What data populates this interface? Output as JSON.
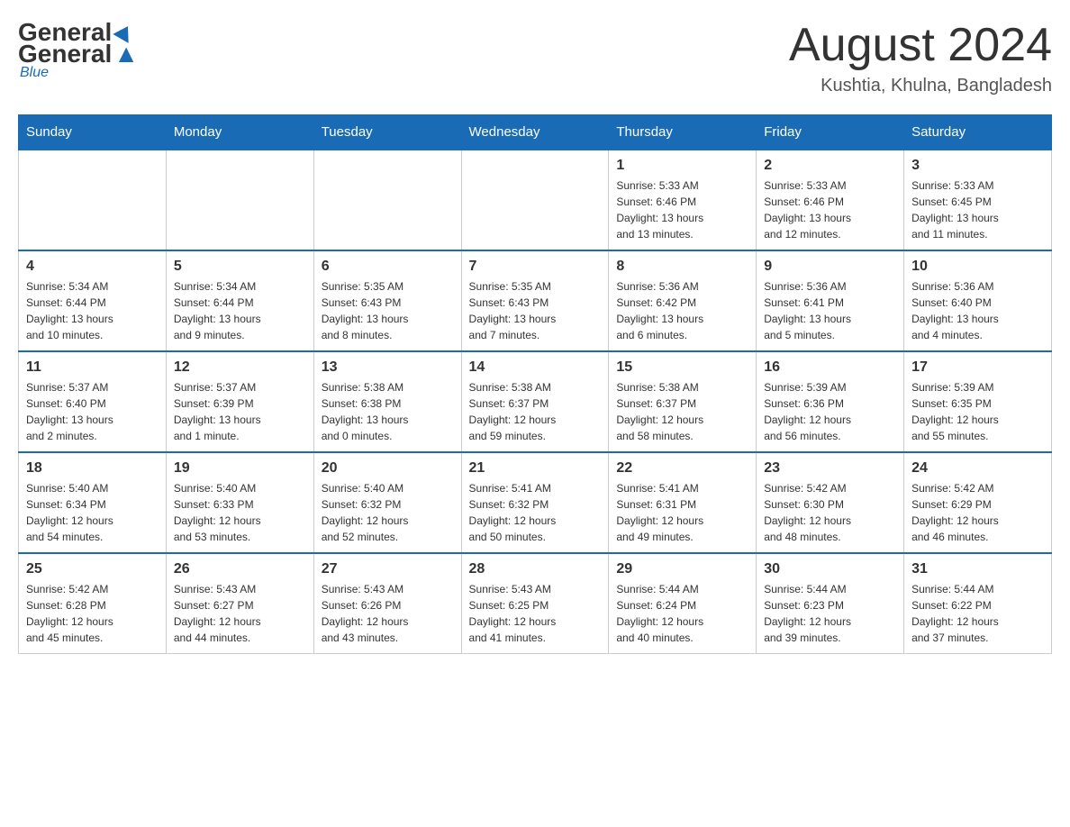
{
  "header": {
    "logo_general": "General",
    "logo_blue": "Blue",
    "month_title": "August 2024",
    "location": "Kushtia, Khulna, Bangladesh"
  },
  "weekdays": [
    "Sunday",
    "Monday",
    "Tuesday",
    "Wednesday",
    "Thursday",
    "Friday",
    "Saturday"
  ],
  "weeks": [
    [
      {
        "day": "",
        "info": ""
      },
      {
        "day": "",
        "info": ""
      },
      {
        "day": "",
        "info": ""
      },
      {
        "day": "",
        "info": ""
      },
      {
        "day": "1",
        "info": "Sunrise: 5:33 AM\nSunset: 6:46 PM\nDaylight: 13 hours\nand 13 minutes."
      },
      {
        "day": "2",
        "info": "Sunrise: 5:33 AM\nSunset: 6:46 PM\nDaylight: 13 hours\nand 12 minutes."
      },
      {
        "day": "3",
        "info": "Sunrise: 5:33 AM\nSunset: 6:45 PM\nDaylight: 13 hours\nand 11 minutes."
      }
    ],
    [
      {
        "day": "4",
        "info": "Sunrise: 5:34 AM\nSunset: 6:44 PM\nDaylight: 13 hours\nand 10 minutes."
      },
      {
        "day": "5",
        "info": "Sunrise: 5:34 AM\nSunset: 6:44 PM\nDaylight: 13 hours\nand 9 minutes."
      },
      {
        "day": "6",
        "info": "Sunrise: 5:35 AM\nSunset: 6:43 PM\nDaylight: 13 hours\nand 8 minutes."
      },
      {
        "day": "7",
        "info": "Sunrise: 5:35 AM\nSunset: 6:43 PM\nDaylight: 13 hours\nand 7 minutes."
      },
      {
        "day": "8",
        "info": "Sunrise: 5:36 AM\nSunset: 6:42 PM\nDaylight: 13 hours\nand 6 minutes."
      },
      {
        "day": "9",
        "info": "Sunrise: 5:36 AM\nSunset: 6:41 PM\nDaylight: 13 hours\nand 5 minutes."
      },
      {
        "day": "10",
        "info": "Sunrise: 5:36 AM\nSunset: 6:40 PM\nDaylight: 13 hours\nand 4 minutes."
      }
    ],
    [
      {
        "day": "11",
        "info": "Sunrise: 5:37 AM\nSunset: 6:40 PM\nDaylight: 13 hours\nand 2 minutes."
      },
      {
        "day": "12",
        "info": "Sunrise: 5:37 AM\nSunset: 6:39 PM\nDaylight: 13 hours\nand 1 minute."
      },
      {
        "day": "13",
        "info": "Sunrise: 5:38 AM\nSunset: 6:38 PM\nDaylight: 13 hours\nand 0 minutes."
      },
      {
        "day": "14",
        "info": "Sunrise: 5:38 AM\nSunset: 6:37 PM\nDaylight: 12 hours\nand 59 minutes."
      },
      {
        "day": "15",
        "info": "Sunrise: 5:38 AM\nSunset: 6:37 PM\nDaylight: 12 hours\nand 58 minutes."
      },
      {
        "day": "16",
        "info": "Sunrise: 5:39 AM\nSunset: 6:36 PM\nDaylight: 12 hours\nand 56 minutes."
      },
      {
        "day": "17",
        "info": "Sunrise: 5:39 AM\nSunset: 6:35 PM\nDaylight: 12 hours\nand 55 minutes."
      }
    ],
    [
      {
        "day": "18",
        "info": "Sunrise: 5:40 AM\nSunset: 6:34 PM\nDaylight: 12 hours\nand 54 minutes."
      },
      {
        "day": "19",
        "info": "Sunrise: 5:40 AM\nSunset: 6:33 PM\nDaylight: 12 hours\nand 53 minutes."
      },
      {
        "day": "20",
        "info": "Sunrise: 5:40 AM\nSunset: 6:32 PM\nDaylight: 12 hours\nand 52 minutes."
      },
      {
        "day": "21",
        "info": "Sunrise: 5:41 AM\nSunset: 6:32 PM\nDaylight: 12 hours\nand 50 minutes."
      },
      {
        "day": "22",
        "info": "Sunrise: 5:41 AM\nSunset: 6:31 PM\nDaylight: 12 hours\nand 49 minutes."
      },
      {
        "day": "23",
        "info": "Sunrise: 5:42 AM\nSunset: 6:30 PM\nDaylight: 12 hours\nand 48 minutes."
      },
      {
        "day": "24",
        "info": "Sunrise: 5:42 AM\nSunset: 6:29 PM\nDaylight: 12 hours\nand 46 minutes."
      }
    ],
    [
      {
        "day": "25",
        "info": "Sunrise: 5:42 AM\nSunset: 6:28 PM\nDaylight: 12 hours\nand 45 minutes."
      },
      {
        "day": "26",
        "info": "Sunrise: 5:43 AM\nSunset: 6:27 PM\nDaylight: 12 hours\nand 44 minutes."
      },
      {
        "day": "27",
        "info": "Sunrise: 5:43 AM\nSunset: 6:26 PM\nDaylight: 12 hours\nand 43 minutes."
      },
      {
        "day": "28",
        "info": "Sunrise: 5:43 AM\nSunset: 6:25 PM\nDaylight: 12 hours\nand 41 minutes."
      },
      {
        "day": "29",
        "info": "Sunrise: 5:44 AM\nSunset: 6:24 PM\nDaylight: 12 hours\nand 40 minutes."
      },
      {
        "day": "30",
        "info": "Sunrise: 5:44 AM\nSunset: 6:23 PM\nDaylight: 12 hours\nand 39 minutes."
      },
      {
        "day": "31",
        "info": "Sunrise: 5:44 AM\nSunset: 6:22 PM\nDaylight: 12 hours\nand 37 minutes."
      }
    ]
  ]
}
